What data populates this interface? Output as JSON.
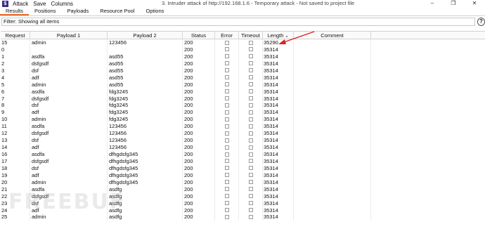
{
  "titlebar": {
    "app_icon": "burp-icon",
    "menu": [
      "Attack",
      "Save",
      "Columns"
    ],
    "window_title": "3. Intruder attack of http://192.168.1.6 - Temporary attack - Not saved to project file",
    "controls": [
      "–",
      "❐",
      "✕"
    ]
  },
  "tabs": [
    {
      "label": "Results",
      "active": true
    },
    {
      "label": "Positions",
      "active": false
    },
    {
      "label": "Payloads",
      "active": false
    },
    {
      "label": "Resource Pool",
      "active": false
    },
    {
      "label": "Options",
      "active": false
    }
  ],
  "filter": {
    "text": "Filter: Showing all items",
    "help": "?"
  },
  "table": {
    "columns": [
      "Request",
      "Payload 1",
      "Payload 2",
      "Status",
      "Error",
      "Timeout",
      "Length",
      "Comment"
    ],
    "sort_indicator": "▲",
    "rows": [
      [
        "15",
        "admin",
        "123456",
        "200",
        "",
        "",
        "35290",
        ""
      ],
      [
        "0",
        "",
        "",
        "200",
        "",
        "",
        "35314",
        ""
      ],
      [
        "1",
        "asdfa",
        "asd55",
        "200",
        "",
        "",
        "35314",
        ""
      ],
      [
        "2",
        "dsfgsdf",
        "asd55",
        "200",
        "",
        "",
        "35314",
        ""
      ],
      [
        "3",
        "dsf",
        "asd55",
        "200",
        "",
        "",
        "35314",
        ""
      ],
      [
        "4",
        "adf",
        "asd55",
        "200",
        "",
        "",
        "35314",
        ""
      ],
      [
        "5",
        "admin",
        "asd55",
        "200",
        "",
        "",
        "35314",
        ""
      ],
      [
        "6",
        "asdfa",
        "fdg3245",
        "200",
        "",
        "",
        "35314",
        ""
      ],
      [
        "7",
        "dsfgsdf",
        "fdg3245",
        "200",
        "",
        "",
        "35314",
        ""
      ],
      [
        "8",
        "dsf",
        "fdg3245",
        "200",
        "",
        "",
        "35314",
        ""
      ],
      [
        "9",
        "adf",
        "fdg3245",
        "200",
        "",
        "",
        "35314",
        ""
      ],
      [
        "10",
        "admin",
        "fdg3245",
        "200",
        "",
        "",
        "35314",
        ""
      ],
      [
        "11",
        "asdfa",
        "123456",
        "200",
        "",
        "",
        "35314",
        ""
      ],
      [
        "12",
        "dsfgsdf",
        "123456",
        "200",
        "",
        "",
        "35314",
        ""
      ],
      [
        "13",
        "dsf",
        "123456",
        "200",
        "",
        "",
        "35314",
        ""
      ],
      [
        "14",
        "adf",
        "123456",
        "200",
        "",
        "",
        "35314",
        ""
      ],
      [
        "16",
        "asdfa",
        "dfhgdsfg345",
        "200",
        "",
        "",
        "35314",
        ""
      ],
      [
        "17",
        "dsfgsdf",
        "dfhgdsfg345",
        "200",
        "",
        "",
        "35314",
        ""
      ],
      [
        "18",
        "dsf",
        "dfhgdsfg345",
        "200",
        "",
        "",
        "35314",
        ""
      ],
      [
        "19",
        "adf",
        "dfhgdsfg345",
        "200",
        "",
        "",
        "35314",
        ""
      ],
      [
        "20",
        "admin",
        "dfhgdsfg345",
        "200",
        "",
        "",
        "35314",
        ""
      ],
      [
        "21",
        "asdfa",
        "asdfg",
        "200",
        "",
        "",
        "35314",
        ""
      ],
      [
        "22",
        "dsfgsdf",
        "asdfg",
        "200",
        "",
        "",
        "35314",
        ""
      ],
      [
        "23",
        "dsf",
        "asdfg",
        "200",
        "",
        "",
        "35314",
        ""
      ],
      [
        "24",
        "adf",
        "asdfg",
        "200",
        "",
        "",
        "35314",
        ""
      ],
      [
        "25",
        "admin",
        "asdfg",
        "200",
        "",
        "",
        "35314",
        ""
      ]
    ]
  },
  "annotation": {
    "color": "#e02020"
  },
  "watermark": "FREEBUF",
  "colors": {
    "active_tab": "#e8692c",
    "app_icon": "#3f2a8a"
  }
}
